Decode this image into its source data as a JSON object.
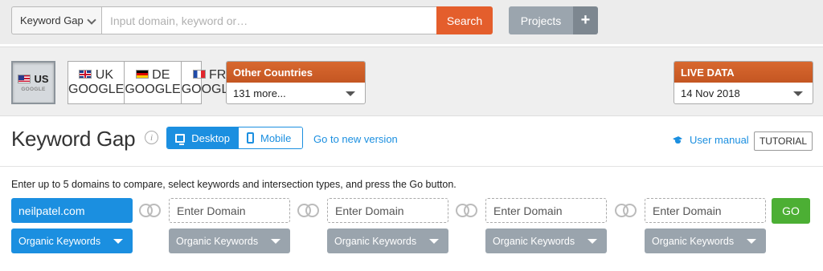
{
  "search_bar": {
    "tool_label": "Keyword Gap",
    "placeholder": "Input domain, keyword or…",
    "search_label": "Search",
    "projects_label": "Projects",
    "add_label": "+"
  },
  "databases": {
    "active": {
      "code": "US",
      "sub": "GOOGLE"
    },
    "group": [
      {
        "code": "UK",
        "sub": "GOOGLE"
      },
      {
        "code": "DE",
        "sub": "GOOGLE"
      },
      {
        "code": "FR",
        "sub": "GOOGLE"
      }
    ],
    "other": {
      "title": "Other Countries",
      "value": "131 more..."
    },
    "live": {
      "title": "LIVE DATA",
      "value": "14 Nov 2018"
    }
  },
  "header": {
    "title": "Keyword Gap",
    "info": "i",
    "tabs": [
      {
        "label": "Desktop"
      },
      {
        "label": "Mobile"
      }
    ],
    "new_version": "Go to new version",
    "manual": "User manual",
    "tutorial": "TUTORIAL"
  },
  "instructions": "Enter up to 5 domains to compare, select keywords and intersection types, and press the Go button.",
  "domains": [
    {
      "value": "neilpatel.com",
      "placeholder": "",
      "keyword_type": "Organic Keywords"
    },
    {
      "value": "",
      "placeholder": "Enter Domain",
      "keyword_type": "Organic Keywords"
    },
    {
      "value": "",
      "placeholder": "Enter Domain",
      "keyword_type": "Organic Keywords"
    },
    {
      "value": "",
      "placeholder": "Enter Domain",
      "keyword_type": "Organic Keywords"
    },
    {
      "value": "",
      "placeholder": "Enter Domain",
      "keyword_type": "Organic Keywords"
    }
  ],
  "go_label": "GO",
  "colors": {
    "accent_blue": "#1b8fe0",
    "search_orange": "#e45e2c",
    "go_green": "#4caf34",
    "grey_button": "#9aa4ad"
  }
}
